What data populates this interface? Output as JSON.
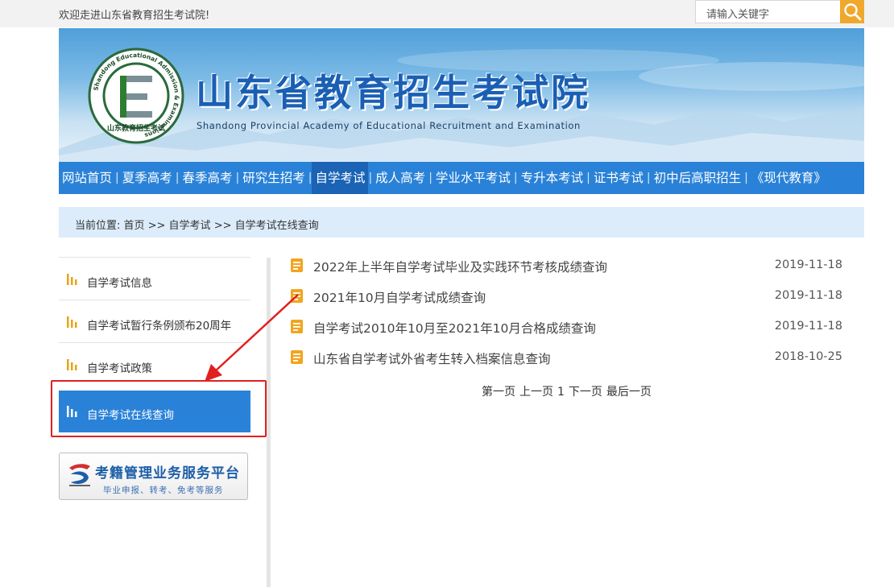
{
  "topbar": {
    "welcome": "欢迎走进山东省教育招生考试院!",
    "search_placeholder": "请输入关键字"
  },
  "header": {
    "title": "山东省教育招生考试院",
    "subtitle": "Shandong Provincial Academy of Educational Recruitment and Examination",
    "logo_ring_text": "Shandong Educational Admission & Examinations",
    "logo_cn_text": "山东教育招生考试"
  },
  "nav": {
    "items": [
      {
        "label": "网站首页"
      },
      {
        "label": "夏季高考"
      },
      {
        "label": "春季高考"
      },
      {
        "label": "研究生招考"
      },
      {
        "label": "自学考试",
        "active": true
      },
      {
        "label": "成人高考"
      },
      {
        "label": "学业水平考试"
      },
      {
        "label": "专升本考试"
      },
      {
        "label": "证书考试"
      },
      {
        "label": "初中后高职招生"
      },
      {
        "label": "《现代教育》"
      }
    ],
    "separator": "|"
  },
  "breadcrumb": {
    "text": "当前位置: 首页 >> 自学考试 >> 自学考试在线查询"
  },
  "sidebar": {
    "items": [
      {
        "label": "自学考试信息"
      },
      {
        "label": "自学考试暂行条例颁布20周年"
      },
      {
        "label": "自学考试政策"
      },
      {
        "label": "自学考试在线查询",
        "active": true
      }
    ],
    "platform": {
      "title": "考籍管理业务服务平台",
      "subtitle": "毕业申报、转考、免考等服务"
    }
  },
  "list": {
    "rows": [
      {
        "title": "2022年上半年自学考试毕业及实践环节考核成绩查询",
        "date": "2019-11-18"
      },
      {
        "title": "2021年10月自学考试成绩查询",
        "date": "2019-11-18"
      },
      {
        "title": "自学考试2010年10月至2021年10月合格成绩查询",
        "date": "2019-11-18"
      },
      {
        "title": "山东省自学考试外省考生转入档案信息查询",
        "date": "2018-10-25"
      }
    ]
  },
  "pager": {
    "first": "第一页",
    "prev": "上一页",
    "current": "1",
    "next": "下一页",
    "last": "最后一页"
  },
  "colors": {
    "nav_blue": "#2a82d8",
    "nav_active": "#1a63b5",
    "crumb_bg": "#dcecfa",
    "accent_orange": "#f0a82c",
    "annotation_red": "#e02020"
  },
  "icons": {
    "search": "magnifier-icon",
    "list_item": "document-icon",
    "sidebar_item": "bar-chart-icon"
  }
}
